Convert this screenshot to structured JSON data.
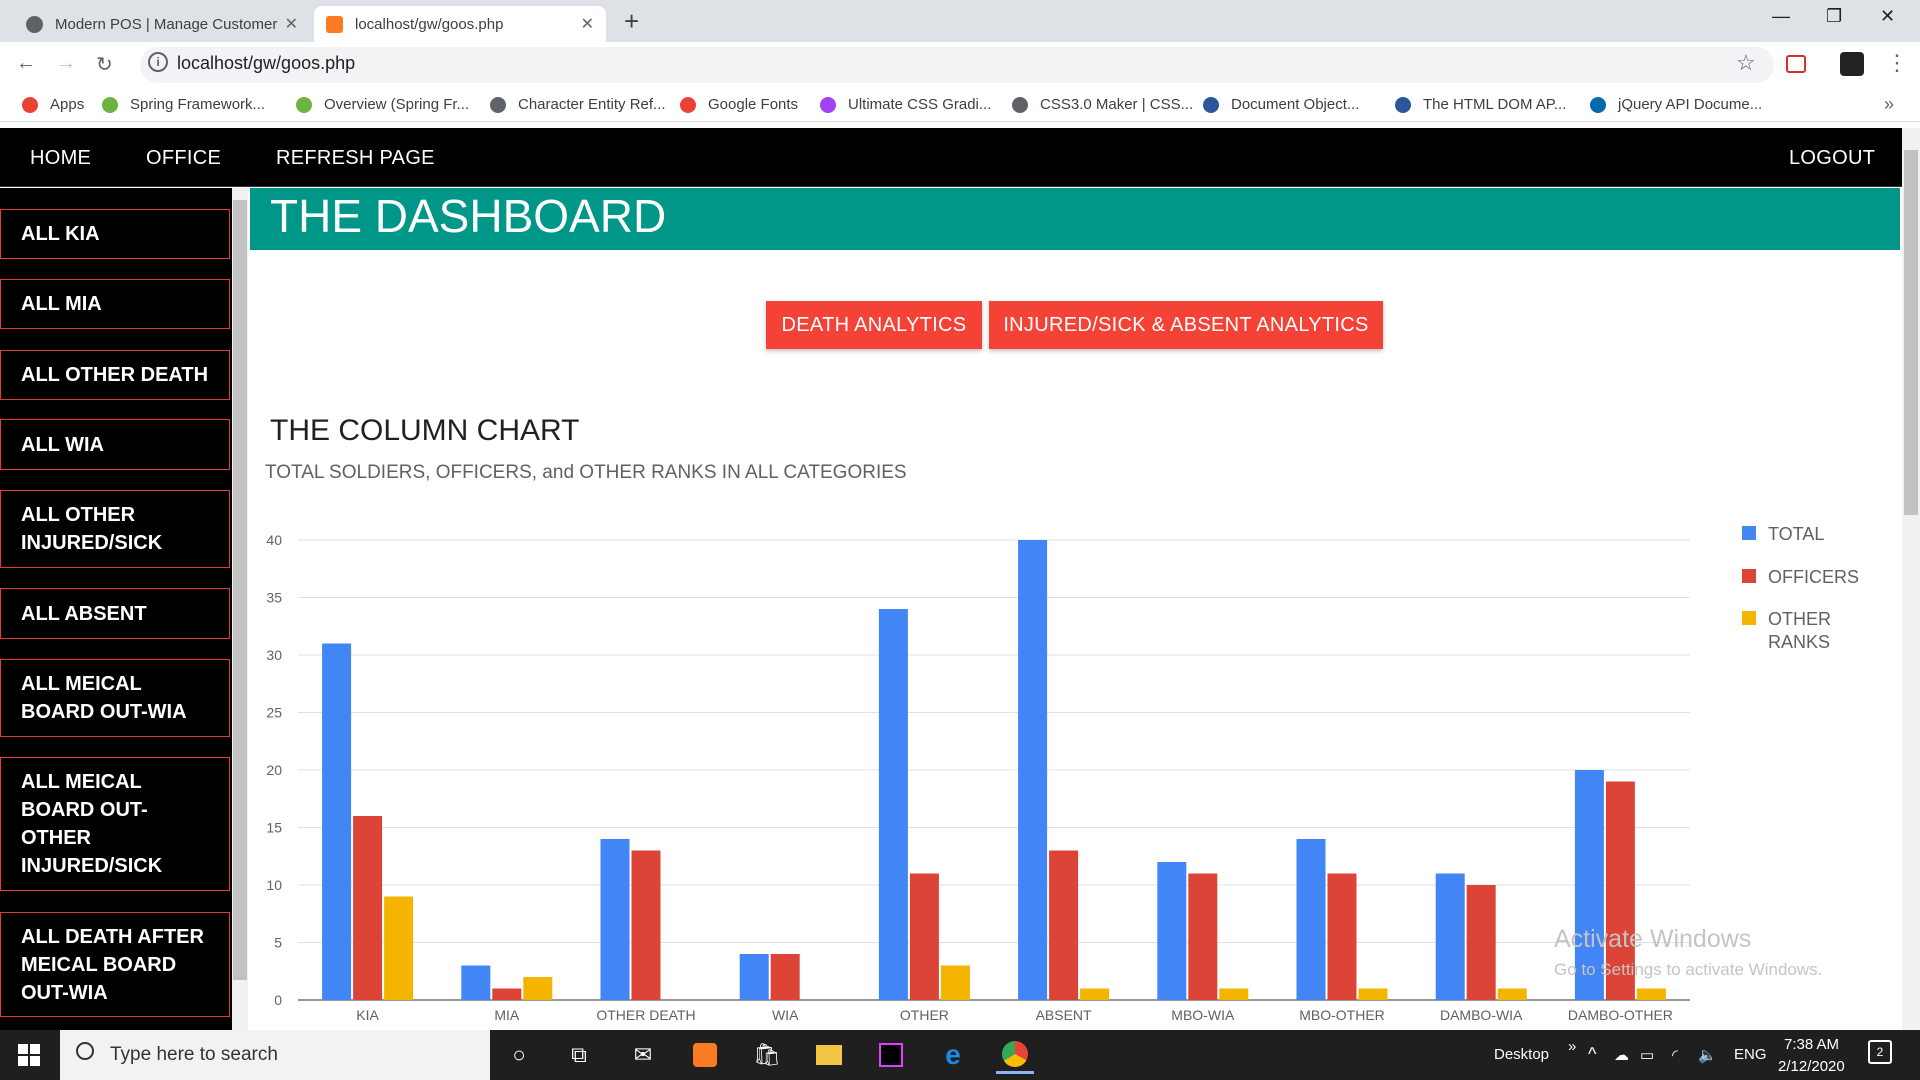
{
  "browser": {
    "tabs": [
      {
        "title": "Modern POS | Manage Customer"
      },
      {
        "title": "localhost/gw/goos.php"
      }
    ],
    "url": "localhost/gw/goos.php",
    "bookmarks": [
      {
        "label": "Apps",
        "color": "#ea4335"
      },
      {
        "label": "Spring Framework...",
        "color": "#6db33f"
      },
      {
        "label": "Overview (Spring Fr...",
        "color": "#6db33f"
      },
      {
        "label": "Character Entity Ref...",
        "color": "#5f6368"
      },
      {
        "label": "Google Fonts",
        "color": "#ea4335"
      },
      {
        "label": "Ultimate CSS Gradi...",
        "color": "#a142f4"
      },
      {
        "label": "CSS3.0 Maker | CSS...",
        "color": "#5f6368"
      },
      {
        "label": "Document Object...",
        "color": "#2b579a"
      },
      {
        "label": "The HTML DOM AP...",
        "color": "#2b579a"
      },
      {
        "label": "jQuery API Docume...",
        "color": "#0769ad"
      }
    ]
  },
  "nav": {
    "home": "HOME",
    "office": "OFFICE",
    "refresh": "REFRESH PAGE",
    "logout": "LOGOUT"
  },
  "sidebar": {
    "items": [
      {
        "label": "ALL KIA"
      },
      {
        "label": "ALL MIA"
      },
      {
        "label": "ALL OTHER DEATH"
      },
      {
        "label": "ALL WIA"
      },
      {
        "label": "ALL OTHER INJURED/SICK"
      },
      {
        "label": "ALL ABSENT"
      },
      {
        "label": "ALL MEICAL BOARD OUT-WIA"
      },
      {
        "label": "ALL MEICAL BOARD OUT-OTHER INJURED/SICK"
      },
      {
        "label": "ALL DEATH AFTER MEICAL BOARD OUT-WIA"
      }
    ]
  },
  "dashboard": {
    "title": "THE DASHBOARD",
    "buttons": {
      "death": "DEATH ANALYTICS",
      "injured": "INJURED/SICK & ABSENT ANALYTICS"
    },
    "chart_title": "THE COLUMN CHART",
    "chart_subtitle": "TOTAL SOLDIERS, OFFICERS, and OTHER RANKS IN ALL CATEGORIES"
  },
  "chart_data": {
    "type": "bar",
    "categories": [
      "KIA",
      "MIA",
      "OTHER DEATH",
      "WIA",
      "OTHER",
      "ABSENT",
      "MBO-WIA",
      "MBO-OTHER",
      "DAMBO-WIA",
      "DAMBO-OTHER"
    ],
    "series": [
      {
        "name": "TOTAL",
        "color": "#4285f4",
        "values": [
          31,
          3,
          14,
          4,
          34,
          40,
          12,
          14,
          11,
          20
        ]
      },
      {
        "name": "OFFICERS",
        "color": "#db4437",
        "values": [
          16,
          1,
          13,
          4,
          11,
          13,
          11,
          11,
          10,
          19
        ]
      },
      {
        "name": "OTHER RANKS",
        "color": "#f4b400",
        "values": [
          9,
          2,
          0,
          0,
          3,
          1,
          1,
          1,
          1,
          1
        ]
      }
    ],
    "ylim": [
      0,
      40
    ],
    "yticks": [
      0,
      5,
      10,
      15,
      20,
      25,
      30,
      35,
      40
    ],
    "grid": true,
    "legend": "right"
  },
  "watermark": {
    "line1": "Activate Windows",
    "line2": "Go to Settings to activate Windows."
  },
  "taskbar": {
    "search_placeholder": "Type here to search",
    "desktop": "Desktop",
    "lang": "ENG",
    "time": "7:38 AM",
    "date": "2/12/2020",
    "notifications": "2"
  }
}
